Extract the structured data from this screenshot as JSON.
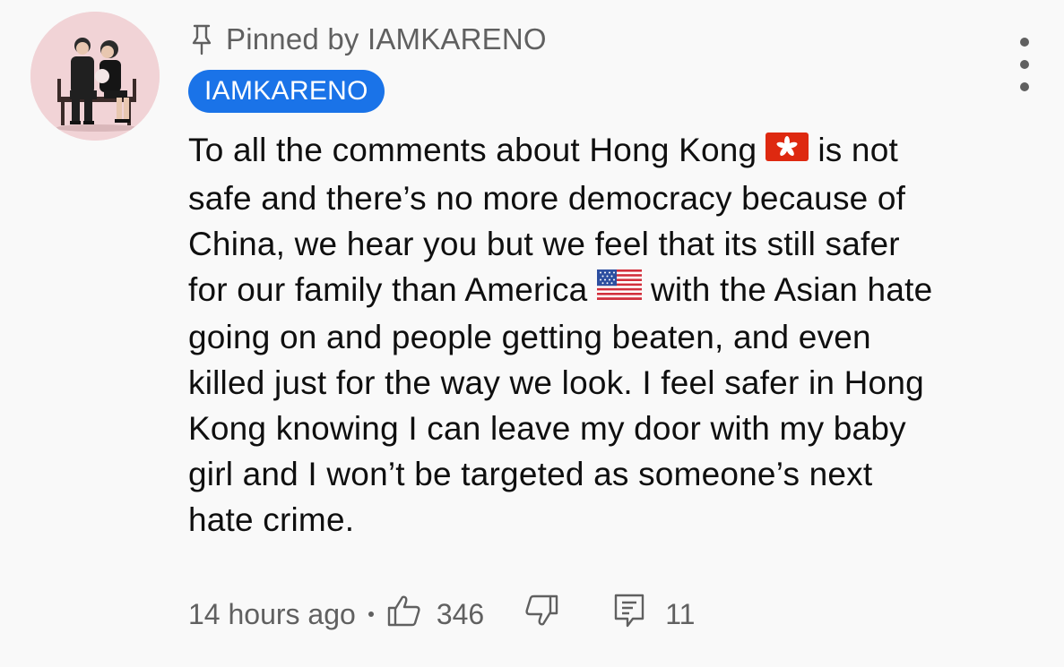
{
  "comment": {
    "pinned_label": "Pinned by IAMKARENO",
    "author": "IAMKARENO",
    "text_parts": {
      "p1": "To all the comments about Hong Kong",
      "p2": "is not safe and there’s no more democracy because of China, we hear you but we feel that its still safer for our family than America",
      "p3": "with the Asian hate going on and people getting beaten, and even killed just for the way we look. I feel safer in Hong Kong knowing I can leave my door with my baby girl and I won’t be targeted as someone’s next hate crime."
    },
    "timestamp": "14 hours ago",
    "like_count": "346",
    "reply_count": "11"
  },
  "icons": {
    "pin": "pin-icon",
    "hk_flag": "hong-kong-flag-icon",
    "us_flag": "us-flag-icon",
    "like": "thumbs-up-icon",
    "dislike": "thumbs-down-icon",
    "reply": "reply-icon",
    "menu": "more-vertical-icon"
  },
  "colors": {
    "background": "#f9f9f9",
    "author_chip": "#1a73e8",
    "secondary_text": "#606060",
    "primary_text": "#0f0f0f",
    "avatar_bg": "#f1d3d6"
  }
}
